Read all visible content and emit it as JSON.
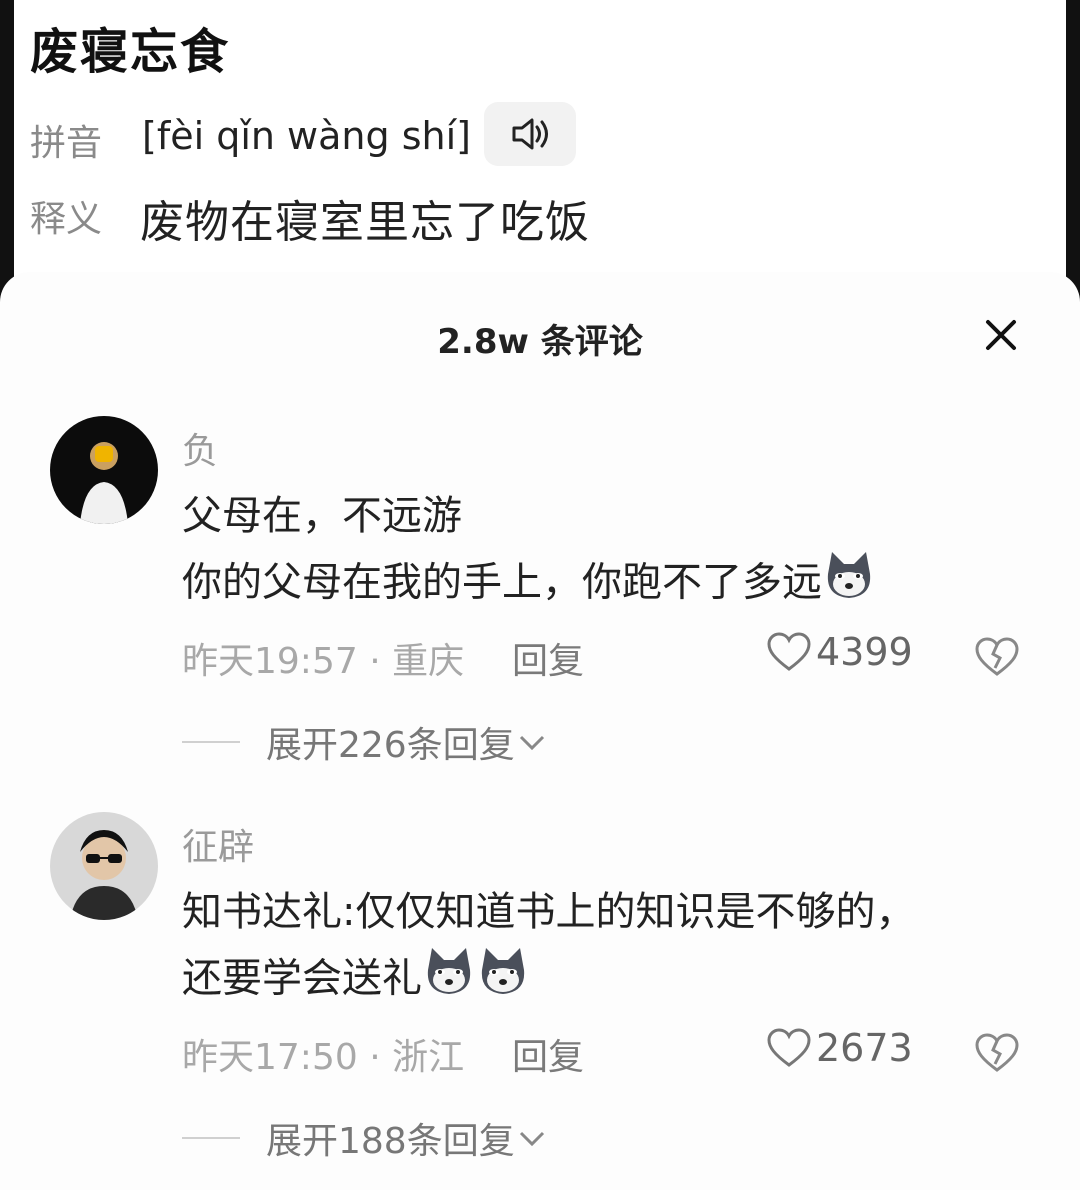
{
  "dictionary": {
    "word": "废寝忘食",
    "pinyin_label": "拼音",
    "pinyin": "[fèi qǐn wàng shí]",
    "meaning_label": "释义",
    "meaning": "废物在寝室里忘了吃饭"
  },
  "comments_panel": {
    "title": "2.8w 条评论",
    "comments": [
      {
        "author": "负",
        "line1": "父母在，不远游",
        "line2": "你的父母在我的手上，你跑不了多远",
        "meta": "昨天19:57 · 重庆",
        "reply": "回复",
        "likes": "4399",
        "expand": "展开226条回复"
      },
      {
        "author": "征辟",
        "line1": "知书达礼:仅仅知道书上的知识是不够的，",
        "line2": "还要学会送礼",
        "meta": "昨天17:50 · 浙江",
        "reply": "回复",
        "likes": "2673",
        "expand": "展开188条回复"
      }
    ]
  },
  "icons": {
    "speaker": "speaker-icon",
    "close": "close-icon",
    "like": "heart-icon",
    "dislike": "broken-heart-icon",
    "emoji": "husky-emoji-icon",
    "chevron": "chevron-down-icon"
  }
}
